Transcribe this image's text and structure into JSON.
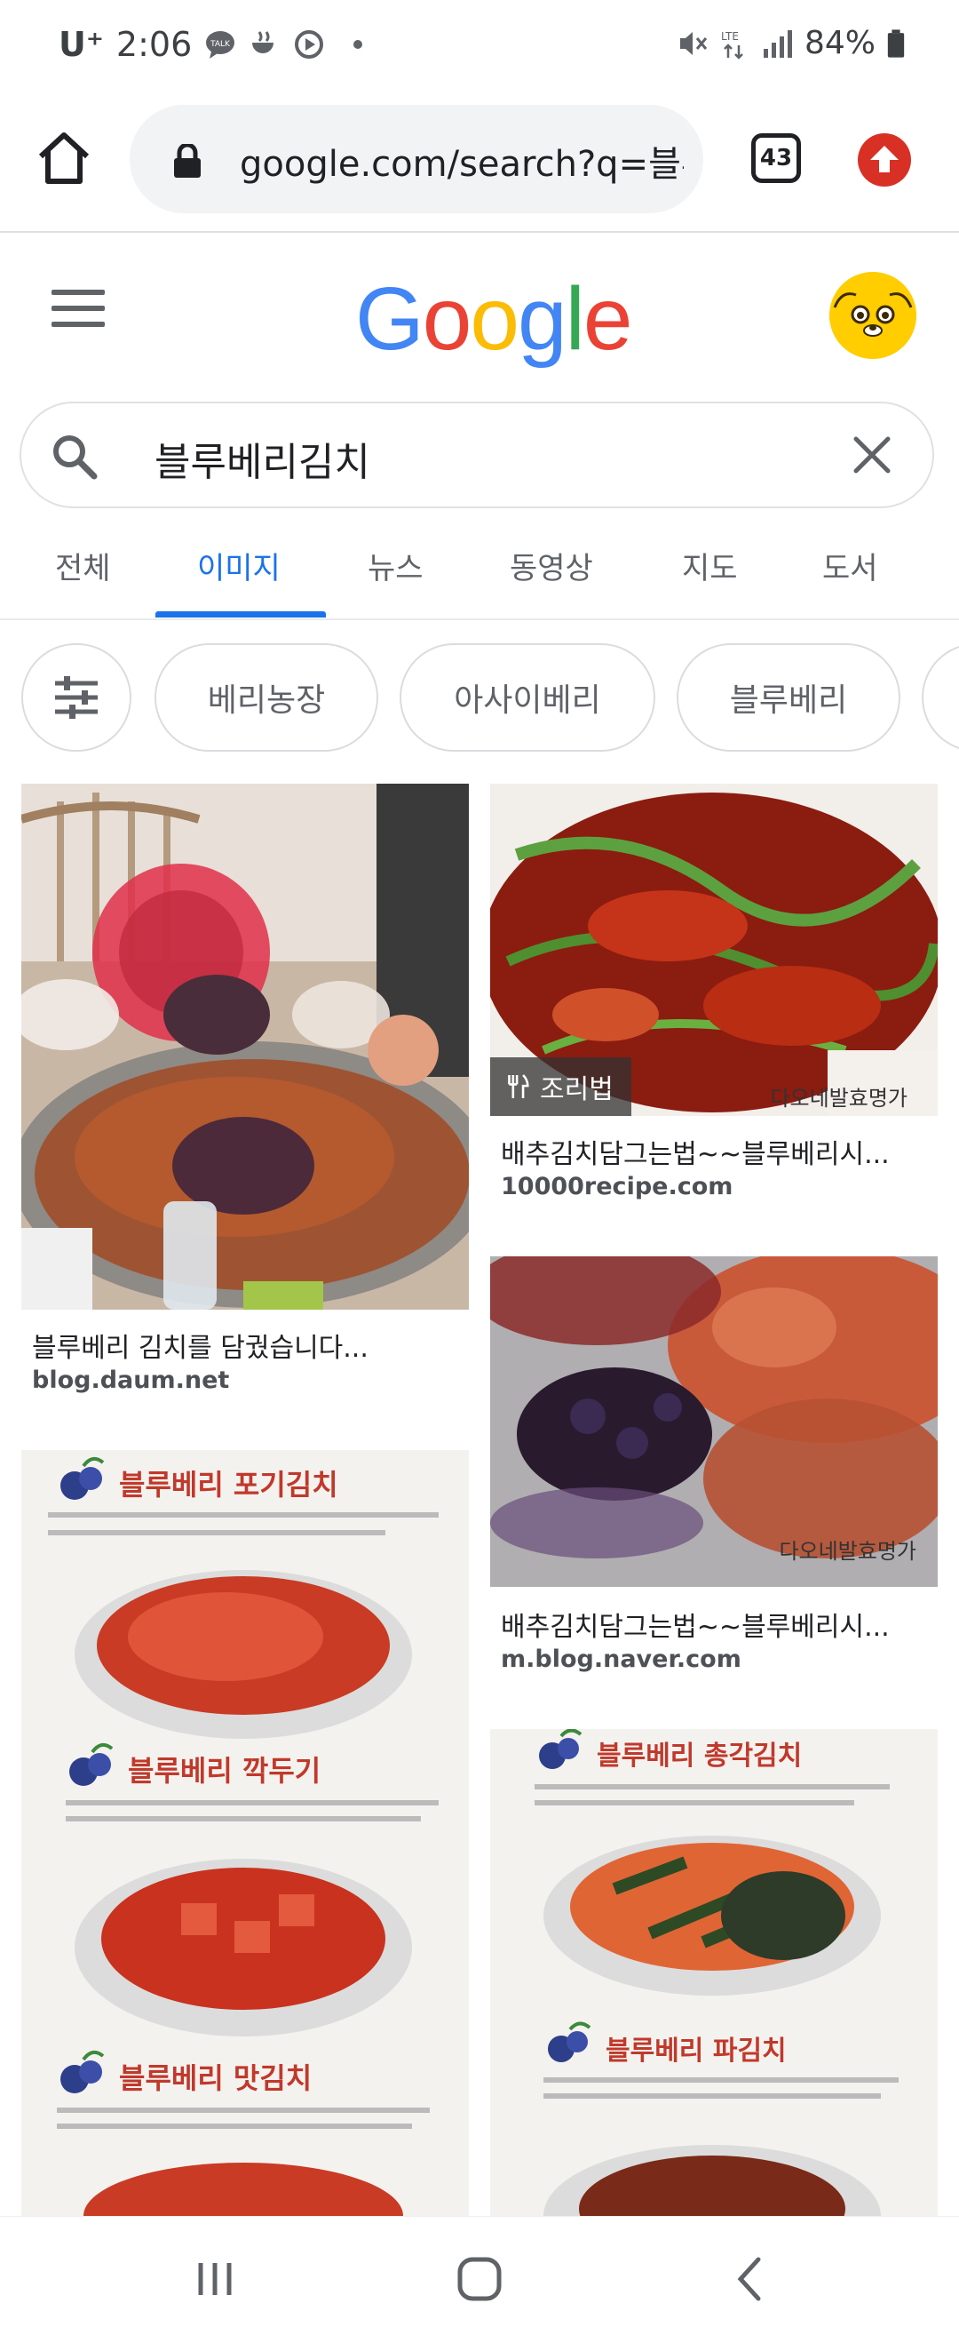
{
  "status_bar": {
    "carrier": "U⁺",
    "time": "2:06",
    "battery": "84%",
    "icons": [
      "talk-icon",
      "mug-icon",
      "play-circle-icon",
      "dot-icon",
      "mute-icon",
      "lte-icon",
      "signal-icon",
      "battery-icon"
    ]
  },
  "browser": {
    "url": "google.com/search?q=블루",
    "tab_count": "43"
  },
  "google": {
    "logo": "Google",
    "query": "블루베리김치"
  },
  "tabs": [
    {
      "label": "전체"
    },
    {
      "label": "이미지"
    },
    {
      "label": "뉴스"
    },
    {
      "label": "동영상"
    },
    {
      "label": "지도"
    },
    {
      "label": "도서"
    }
  ],
  "active_tab": "이미지",
  "chips": [
    {
      "label": "베리농장"
    },
    {
      "label": "아사이베리"
    },
    {
      "label": "블루베리"
    }
  ],
  "results": [
    {
      "title": "블루베리 김치를 담궜습니다...",
      "source": "blog.daum.net"
    },
    {
      "title": "배추김치담그는법~~블루베리시...",
      "source": "10000recipe.com",
      "badge": "조리법",
      "watermark": "다오네발효명가"
    },
    {
      "title": "배추김치담그는법~~블루베리시...",
      "source": "m.blog.naver.com",
      "watermark": "다오네발효명가"
    },
    {
      "panel_texts": [
        "블루베리 포기김치",
        "블루베리 깍두기",
        "블루베리 맛김치"
      ]
    },
    {
      "panel_texts": [
        "블루베리 총각김치",
        "블루베리 파김치"
      ]
    }
  ],
  "colors": {
    "accent": "#1a73e8",
    "google_blue": "#4285f4",
    "google_red": "#ea4335",
    "google_yellow": "#fbbc05",
    "google_green": "#34a853",
    "update_red": "#d93025"
  }
}
